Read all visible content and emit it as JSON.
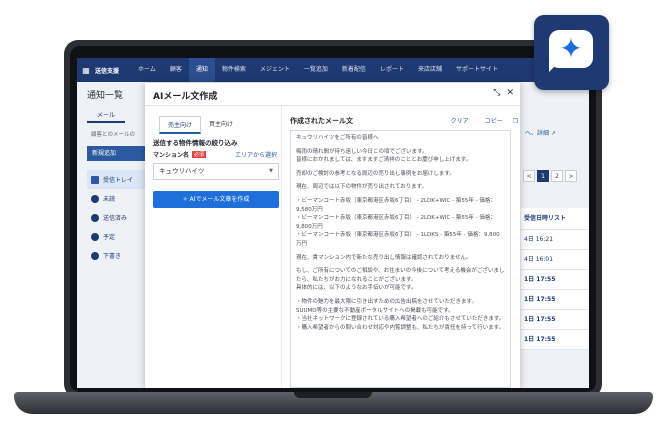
{
  "topnav": {
    "logo": "送信支援",
    "items": [
      "ホーム",
      "顧客",
      "通知",
      "物件検索",
      "メジェント",
      "一覧追加",
      "新着配信",
      "レポート",
      "来店店舗",
      "サポートサイト"
    ],
    "active_index": 2
  },
  "page": {
    "title": "通知一覧",
    "tab": "メール",
    "description": "顧客とのメールの",
    "new_button": "新規追加",
    "detail_link": "へ、詳細",
    "sidebar": [
      "受信トレイ",
      "未読",
      "送信済み",
      "予定",
      "下書き"
    ],
    "pager": [
      "<",
      "1",
      "2",
      ">"
    ],
    "pager_active": "1",
    "table_header": "受信日時リスト",
    "table_rows": [
      "4日 16:21",
      "4日 16:01",
      "1日 17:55",
      "1日 17:55",
      "1日 17:55",
      "1日 17:55"
    ]
  },
  "modal": {
    "title": "AIメール文作成",
    "minimize_icon": "✕",
    "close_icon": "×",
    "tabs": [
      "売主向け",
      "買主向け"
    ],
    "active_tab": 0,
    "section_title": "送信する物件情報の絞り込み",
    "field_label": "マンション名",
    "required_badge": "必須",
    "area_link": "エリアから選択",
    "select_value": "キュウリハイツ",
    "generate_button": "AIでメール文章を作成",
    "result_title": "作成されたメール文",
    "clear_label": "クリア",
    "copy_label": "コピー",
    "result_paragraphs": [
      "キュウリハイツをご所有の皆様へ",
      "梅雨の晴れ間が待ち遠しい今日この頃でございます。\n皆様におかれましては、ますますご清祥のこととお慶び申し上げます。",
      "売却のご検討の参考となる周辺の売り出し事例をお届けします。",
      "現在、周辺では以下の物件が売り出されております。",
      "・ビーマンコート赤坂（東京都港区赤坂6丁目） - 2LDK+WIC - 築55年 - 価格：9,580万円\n・ビーマンコート赤坂（東京都港区赤坂6丁目） - 2LDK+WIC - 築55年 - 価格：9,800万円\n・ビーマンコート赤坂（東京都港区赤坂6丁目） - 1LDKS - 築55年 - 価格：9,800万円",
      "現在、貴マンション内で新たな売り出し情報は確認されておりません。",
      "もし、ご所有についてのご相談や、お住まいの今後について考える機会がございましたら、私たちがお力になれることがございます。\n具体的には、以下のようなお手伝いが可能です。",
      "・物件の魅力を最大限に引き出すための広告出稿をさせていただきます。\nSUUMO等の主要な不動産ポータルサイトへの掲載も可能です。\n・当社ネットワークに登録されている購入希望者へのご紹介もさせていただきます。\n・購入希望者からの問い合わせ対応や内覧調整も、私たちが責任を持って行います。"
    ]
  },
  "colors": {
    "brand": "#1f3a73",
    "primary_button": "#1e6fd9",
    "link": "#2c5aa0",
    "required": "#e0443e"
  },
  "badge": {
    "icon": "sparkle-chat-icon"
  }
}
